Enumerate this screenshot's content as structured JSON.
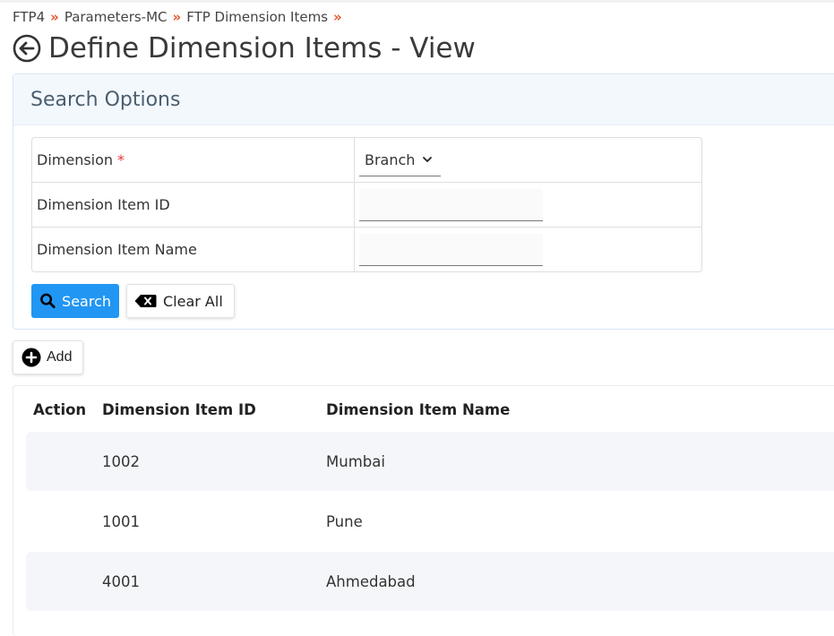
{
  "breadcrumb": {
    "items": [
      "FTP4",
      "Parameters-MC",
      "FTP Dimension Items"
    ],
    "separator": "»"
  },
  "page": {
    "title": "Define Dimension Items - View",
    "back_icon": "arrow-left-circle-icon"
  },
  "search": {
    "header": "Search Options",
    "fields": {
      "dimension": {
        "label": "Dimension",
        "required_mark": "*",
        "value": "Branch"
      },
      "item_id": {
        "label": "Dimension Item ID",
        "value": ""
      },
      "item_name": {
        "label": "Dimension Item Name",
        "value": ""
      }
    },
    "search_button": "Search",
    "clear_button": "Clear All"
  },
  "toolbar": {
    "add_button": "Add"
  },
  "table": {
    "columns": [
      "Action",
      "Dimension Item ID",
      "Dimension Item Name"
    ],
    "rows": [
      {
        "action": "",
        "id": "1002",
        "name": "Mumbai"
      },
      {
        "action": "",
        "id": "1001",
        "name": "Pune"
      },
      {
        "action": "",
        "id": "4001",
        "name": "Ahmedabad"
      }
    ]
  },
  "colors": {
    "accent": "#2196f3",
    "breadcrumb_separator": "#e4572e",
    "required": "#e53935"
  }
}
